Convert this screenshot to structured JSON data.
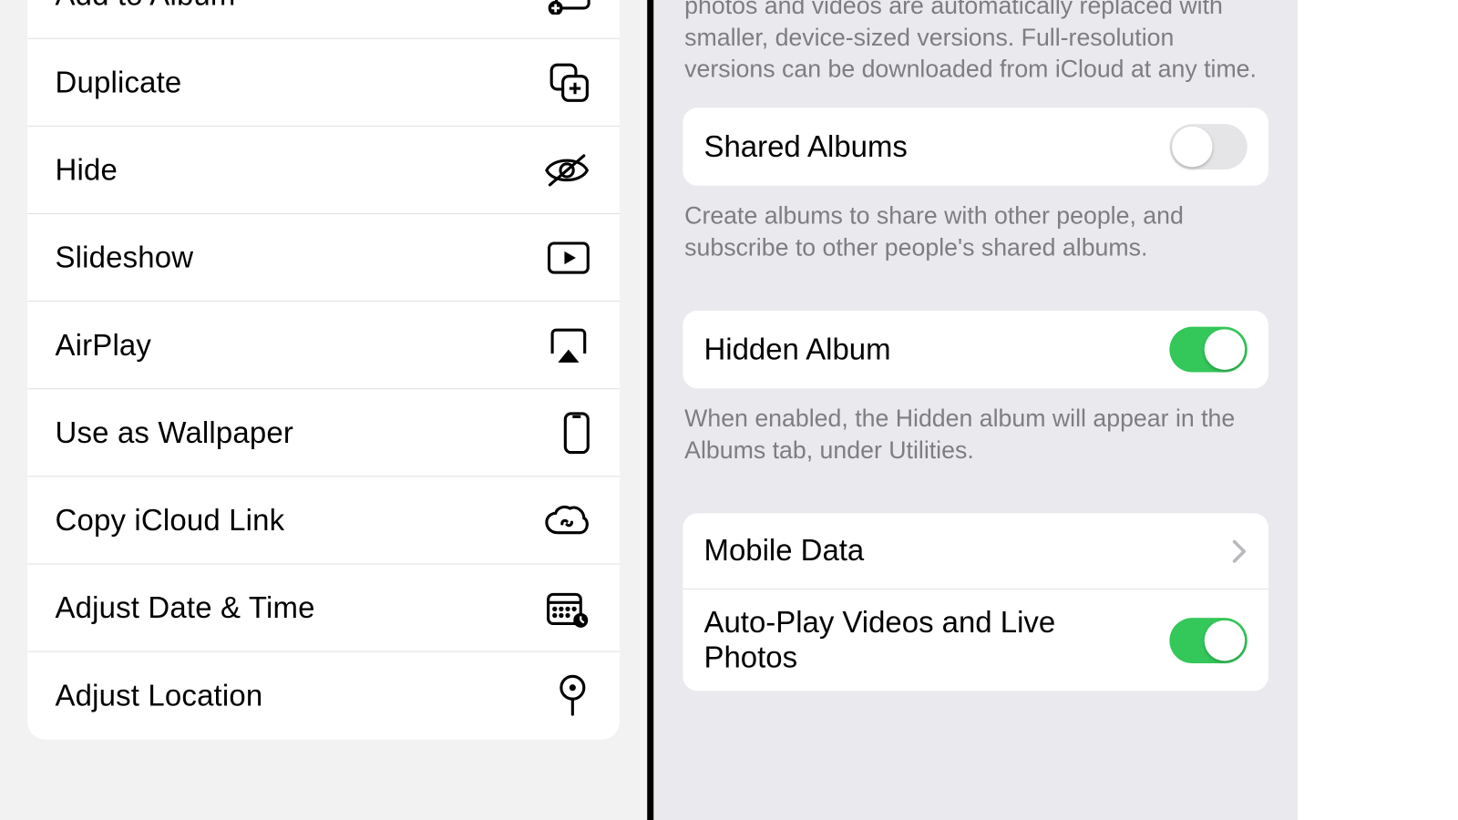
{
  "menu": {
    "items": [
      {
        "key": "add-to-album",
        "label": "Add to Album",
        "icon": "album-add-icon"
      },
      {
        "key": "duplicate",
        "label": "Duplicate",
        "icon": "duplicate-icon"
      },
      {
        "key": "hide",
        "label": "Hide",
        "icon": "eye-slash-icon"
      },
      {
        "key": "slideshow",
        "label": "Slideshow",
        "icon": "play-rect-icon"
      },
      {
        "key": "airplay",
        "label": "AirPlay",
        "icon": "airplay-icon"
      },
      {
        "key": "wallpaper",
        "label": "Use as Wallpaper",
        "icon": "iphone-icon"
      },
      {
        "key": "copy-icloud",
        "label": "Copy iCloud Link",
        "icon": "cloud-link-icon"
      },
      {
        "key": "adjust-date",
        "label": "Adjust Date & Time",
        "icon": "calendar-clock-icon"
      },
      {
        "key": "adjust-location",
        "label": "Adjust Location",
        "icon": "pin-circle-icon"
      }
    ]
  },
  "settings": {
    "top_desc": "photos and videos are automatically replaced with smaller, device-sized versions. Full-resolution versions can be downloaded from iCloud at any time.",
    "shared_albums": {
      "label": "Shared Albums",
      "desc": "Create albums to share with other people, and subscribe to other people's shared albums.",
      "on": false
    },
    "hidden_album": {
      "label": "Hidden Album",
      "desc": "When enabled, the Hidden album will appear in the Albums tab, under Utilities.",
      "on": true
    },
    "mobile_data": {
      "label": "Mobile Data"
    },
    "autoplay": {
      "label": "Auto-Play Videos and Live Photos",
      "on": true
    }
  }
}
